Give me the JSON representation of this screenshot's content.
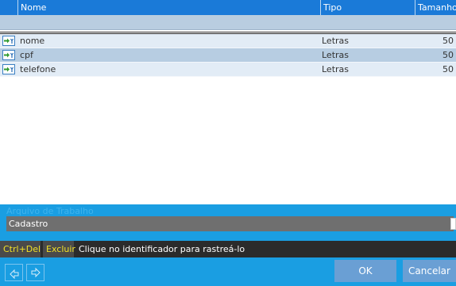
{
  "grid": {
    "columns": [
      "Nome",
      "Tipo",
      "Tamanho"
    ],
    "rows": [
      {
        "icon": "field-icon",
        "name": "nome",
        "type": "Letras",
        "size": "50",
        "selected": false
      },
      {
        "icon": "field-icon",
        "name": "cpf",
        "type": "Letras",
        "size": "50",
        "selected": true
      },
      {
        "icon": "field-icon",
        "name": "telefone",
        "type": "Letras",
        "size": "50",
        "selected": false
      }
    ]
  },
  "workfile": {
    "label": "Arquivo de Trabalho",
    "value": "Cadastro"
  },
  "hints": {
    "key1": "Ctrl+Del",
    "key2": "Excluir",
    "text": "Clique no identificador para rastreá-lo"
  },
  "buttons": {
    "ok": "OK",
    "cancel": "Cancelar"
  },
  "colors": {
    "header": "#1a7ad8",
    "panel": "#1a9ee2",
    "row": "#e2ecf6",
    "row_selected": "#b7cde2",
    "hint_bar": "#2b2b2b",
    "hint_key": "#f0e028",
    "button": "#6a9fd4"
  }
}
